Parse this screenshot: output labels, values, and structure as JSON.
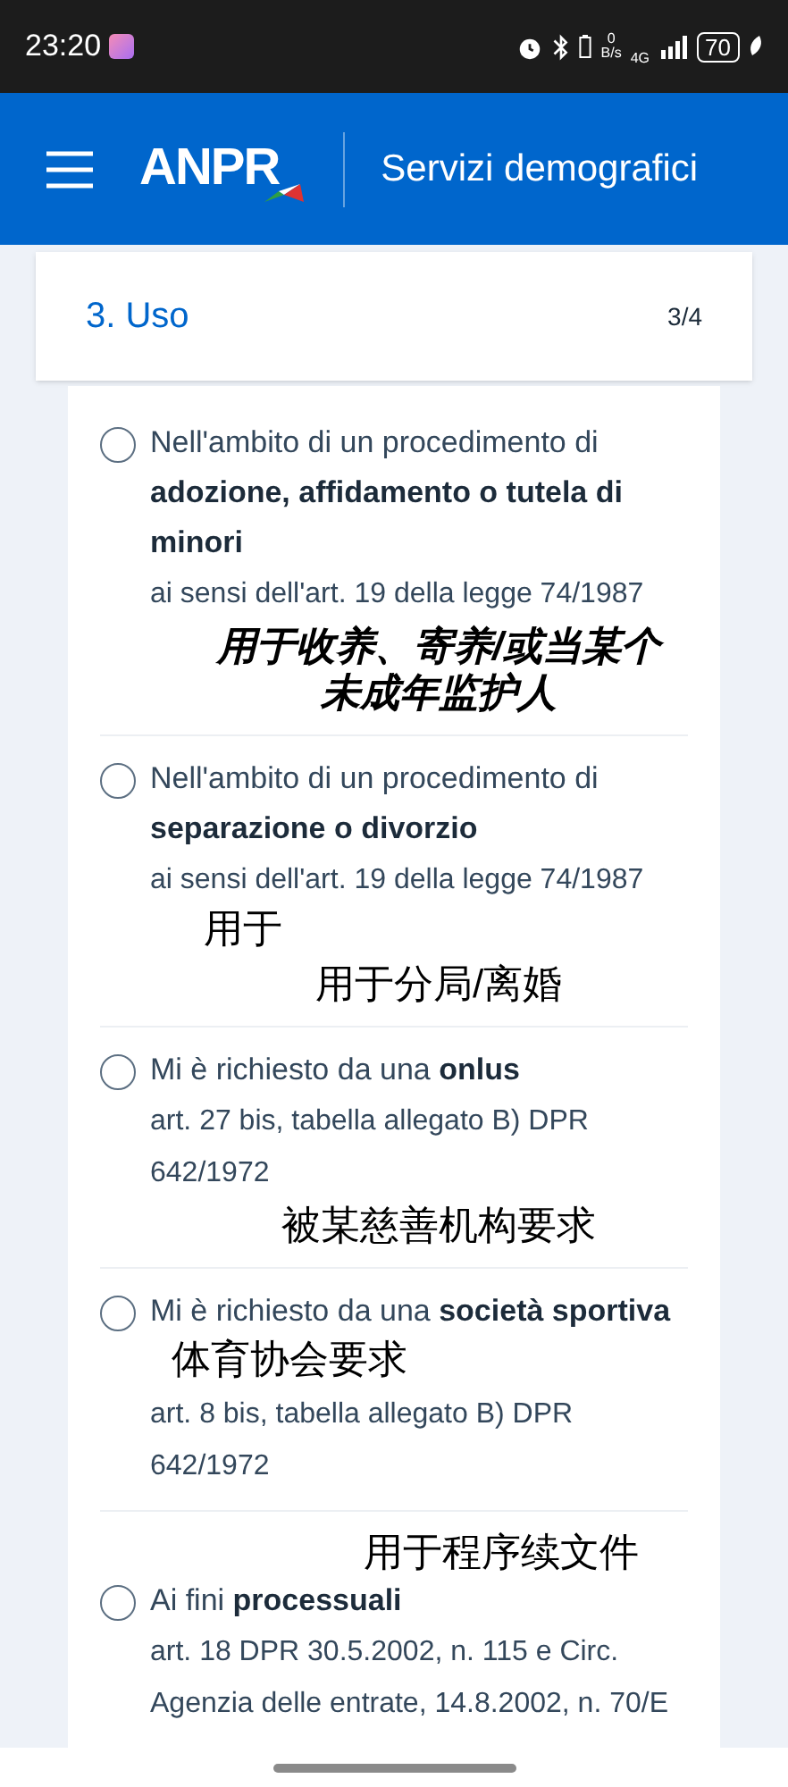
{
  "status_bar": {
    "time": "23:20",
    "network_speed_value": "0",
    "network_speed_unit": "B/s",
    "network_type": "4G",
    "battery": "70"
  },
  "header": {
    "logo": "ANPR",
    "title": "Servizi demografici"
  },
  "step": {
    "title": "3. Uso",
    "counter": "3/4"
  },
  "options": [
    {
      "text": "Nell'ambito di un procedimento di **adozione, affidamento o tutela di minori**",
      "note": "ai sensi dell'art. 19 della legge 74/1987",
      "selected": false,
      "annotations": [
        "用于收养、寄养/或当某个未成年监护人"
      ]
    },
    {
      "text": "Nell'ambito di un procedimento di **separazione o divorzio**",
      "note": "ai sensi dell'art. 19 della legge 74/1987",
      "selected": false,
      "annotations": [
        "用于",
        "用于分局/离婚"
      ]
    },
    {
      "text": "Mi è richiesto da una **onlus**",
      "note": "art. 27 bis, tabella allegato B) DPR 642/1972",
      "selected": false,
      "annotations": [
        "被某慈善机构要求"
      ]
    },
    {
      "text": "Mi è richiesto da una **società sportiva**",
      "note": "art. 8 bis, tabella allegato B) DPR 642/1972",
      "selected": false,
      "annotations": [
        "体育协会要求"
      ]
    },
    {
      "text": "Ai fini **processuali**",
      "note": "art. 18 DPR 30.5.2002, n. 115 e Circ. Agenzia delle entrate, 14.8.2002, n. 70/E",
      "selected": false,
      "annotations": [
        "用于程序续文件"
      ]
    }
  ]
}
